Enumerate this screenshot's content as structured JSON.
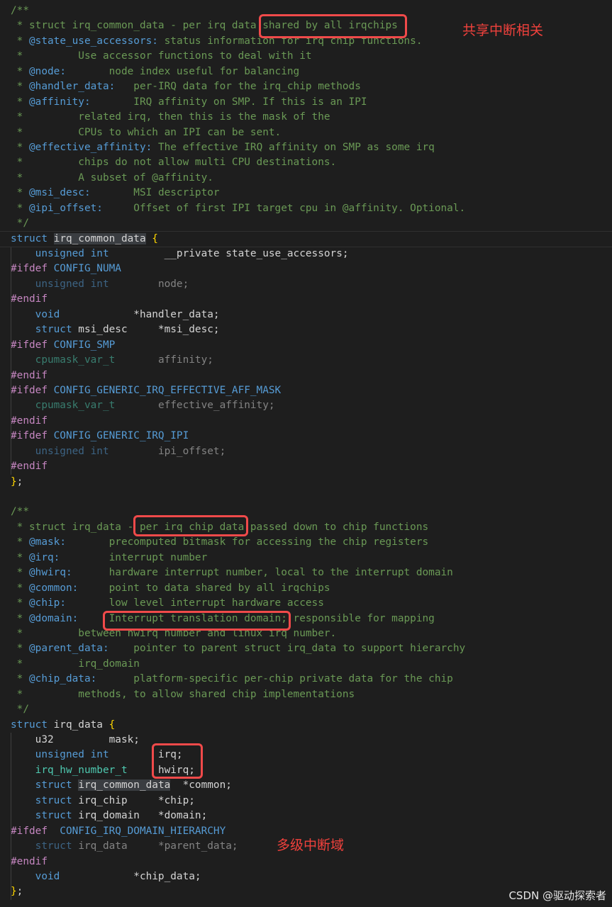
{
  "lines": [
    [
      {
        "t": "/**",
        "c": "c"
      }
    ],
    [
      {
        "t": " * struct irq_common_data - per irq data shared by all irqchips",
        "c": "c"
      }
    ],
    [
      {
        "t": " * ",
        "c": "c"
      },
      {
        "t": "@state_use_accessors:",
        "c": "ct"
      },
      {
        "t": " status information for irq chip functions.",
        "c": "c"
      }
    ],
    [
      {
        "t": " *         Use accessor functions to deal with it",
        "c": "c"
      }
    ],
    [
      {
        "t": " * ",
        "c": "c"
      },
      {
        "t": "@node:",
        "c": "ct"
      },
      {
        "t": "       node index useful for balancing",
        "c": "c"
      }
    ],
    [
      {
        "t": " * ",
        "c": "c"
      },
      {
        "t": "@handler_data:",
        "c": "ct"
      },
      {
        "t": "   per-IRQ data for the irq_chip methods",
        "c": "c"
      }
    ],
    [
      {
        "t": " * ",
        "c": "c"
      },
      {
        "t": "@affinity:",
        "c": "ct"
      },
      {
        "t": "       IRQ affinity on SMP. If this is an IPI",
        "c": "c"
      }
    ],
    [
      {
        "t": " *         related irq, then this is the mask of the",
        "c": "c"
      }
    ],
    [
      {
        "t": " *         CPUs to which an IPI can be sent.",
        "c": "c"
      }
    ],
    [
      {
        "t": " * ",
        "c": "c"
      },
      {
        "t": "@effective_affinity:",
        "c": "ct"
      },
      {
        "t": " The effective IRQ affinity on SMP as some irq",
        "c": "c"
      }
    ],
    [
      {
        "t": " *         chips do not allow multi CPU destinations.",
        "c": "c"
      }
    ],
    [
      {
        "t": " *         A subset of @affinity.",
        "c": "c"
      }
    ],
    [
      {
        "t": " * ",
        "c": "c"
      },
      {
        "t": "@msi_desc:",
        "c": "ct"
      },
      {
        "t": "       MSI descriptor",
        "c": "c"
      }
    ],
    [
      {
        "t": " * ",
        "c": "c"
      },
      {
        "t": "@ipi_offset:",
        "c": "ct"
      },
      {
        "t": "     Offset of first IPI target cpu in @affinity. Optional.",
        "c": "c"
      }
    ],
    [
      {
        "t": " */",
        "c": "c"
      }
    ],
    [
      {
        "t": "struct",
        "c": "k"
      },
      {
        "t": " ",
        "c": "x"
      },
      {
        "t": "irq_common_data",
        "c": "hl"
      },
      {
        "t": " ",
        "c": "x"
      },
      {
        "t": "{",
        "c": "b"
      }
    ],
    [
      {
        "t": "    ",
        "c": "x"
      },
      {
        "t": "unsigned int",
        "c": "k"
      },
      {
        "t": "         __private state_use_accessors;",
        "c": "f"
      }
    ],
    [
      {
        "t": "#ifdef",
        "c": "p"
      },
      {
        "t": " CONFIG_NUMA",
        "c": "m"
      }
    ],
    [
      {
        "t": "    unsigned int        ",
        "c": "k",
        "dim": true
      },
      {
        "t": "node;",
        "c": "f",
        "dim": true
      }
    ],
    [
      {
        "t": "#endif",
        "c": "p"
      }
    ],
    [
      {
        "t": "    ",
        "c": "x"
      },
      {
        "t": "void",
        "c": "k"
      },
      {
        "t": "            *handler_data;",
        "c": "f"
      }
    ],
    [
      {
        "t": "    ",
        "c": "x"
      },
      {
        "t": "struct",
        "c": "k"
      },
      {
        "t": " msi_desc     *msi_desc;",
        "c": "f"
      }
    ],
    [
      {
        "t": "#ifdef",
        "c": "p"
      },
      {
        "t": " CONFIG_SMP",
        "c": "m"
      }
    ],
    [
      {
        "t": "    cpumask_var_t       ",
        "c": "t",
        "dim": true
      },
      {
        "t": "affinity;",
        "c": "f",
        "dim": true
      }
    ],
    [
      {
        "t": "#endif",
        "c": "p"
      }
    ],
    [
      {
        "t": "#ifdef",
        "c": "p"
      },
      {
        "t": " CONFIG_GENERIC_IRQ_EFFECTIVE_AFF_MASK",
        "c": "m"
      }
    ],
    [
      {
        "t": "    cpumask_var_t       ",
        "c": "t",
        "dim": true
      },
      {
        "t": "effective_affinity;",
        "c": "f",
        "dim": true
      }
    ],
    [
      {
        "t": "#endif",
        "c": "p"
      }
    ],
    [
      {
        "t": "#ifdef",
        "c": "p"
      },
      {
        "t": " CONFIG_GENERIC_IRQ_IPI",
        "c": "m"
      }
    ],
    [
      {
        "t": "    unsigned int        ",
        "c": "k",
        "dim": true
      },
      {
        "t": "ipi_offset;",
        "c": "f",
        "dim": true
      }
    ],
    [
      {
        "t": "#endif",
        "c": "p"
      }
    ],
    [
      {
        "t": "}",
        "c": "b"
      },
      {
        "t": ";",
        "c": "x"
      }
    ],
    [],
    [
      {
        "t": "/**",
        "c": "c"
      }
    ],
    [
      {
        "t": " * struct irq_data - per irq chip data passed down to chip functions",
        "c": "c"
      }
    ],
    [
      {
        "t": " * ",
        "c": "c"
      },
      {
        "t": "@mask:",
        "c": "ct"
      },
      {
        "t": "       precomputed bitmask for accessing the chip registers",
        "c": "c"
      }
    ],
    [
      {
        "t": " * ",
        "c": "c"
      },
      {
        "t": "@irq:",
        "c": "ct"
      },
      {
        "t": "        interrupt number",
        "c": "c"
      }
    ],
    [
      {
        "t": " * ",
        "c": "c"
      },
      {
        "t": "@hwirq:",
        "c": "ct"
      },
      {
        "t": "      hardware interrupt number, local to the interrupt domain",
        "c": "c"
      }
    ],
    [
      {
        "t": " * ",
        "c": "c"
      },
      {
        "t": "@common:",
        "c": "ct"
      },
      {
        "t": "     point to data shared by all irqchips",
        "c": "c"
      }
    ],
    [
      {
        "t": " * ",
        "c": "c"
      },
      {
        "t": "@chip:",
        "c": "ct"
      },
      {
        "t": "       low level interrupt hardware access",
        "c": "c"
      }
    ],
    [
      {
        "t": " * ",
        "c": "c"
      },
      {
        "t": "@domain:",
        "c": "ct"
      },
      {
        "t": "     Interrupt translation domain; responsible for mapping",
        "c": "c"
      }
    ],
    [
      {
        "t": " *         between hwirq number and linux irq number.",
        "c": "c"
      }
    ],
    [
      {
        "t": " * ",
        "c": "c"
      },
      {
        "t": "@parent_data:",
        "c": "ct"
      },
      {
        "t": "    pointer to parent struct irq_data to support hierarchy",
        "c": "c"
      }
    ],
    [
      {
        "t": " *         irq_domain",
        "c": "c"
      }
    ],
    [
      {
        "t": " * ",
        "c": "c"
      },
      {
        "t": "@chip_data:",
        "c": "ct"
      },
      {
        "t": "      platform-specific per-chip private data for the chip",
        "c": "c"
      }
    ],
    [
      {
        "t": " *         methods, to allow shared chip implementations",
        "c": "c"
      }
    ],
    [
      {
        "t": " */",
        "c": "c"
      }
    ],
    [
      {
        "t": "struct",
        "c": "k"
      },
      {
        "t": " irq_data ",
        "c": "f"
      },
      {
        "t": "{",
        "c": "b"
      }
    ],
    [
      {
        "t": "    u32         mask;",
        "c": "f"
      }
    ],
    [
      {
        "t": "    ",
        "c": "x"
      },
      {
        "t": "unsigned int",
        "c": "k"
      },
      {
        "t": "        irq;",
        "c": "f"
      }
    ],
    [
      {
        "t": "    ",
        "c": "x"
      },
      {
        "t": "irq_hw_number_t",
        "c": "t"
      },
      {
        "t": "     hwirq;",
        "c": "f"
      }
    ],
    [
      {
        "t": "    ",
        "c": "x"
      },
      {
        "t": "struct",
        "c": "k"
      },
      {
        "t": " ",
        "c": "x"
      },
      {
        "t": "irq_common_data",
        "c": "hl"
      },
      {
        "t": "  *common;",
        "c": "f"
      }
    ],
    [
      {
        "t": "    ",
        "c": "x"
      },
      {
        "t": "struct",
        "c": "k"
      },
      {
        "t": " irq_chip     *chip;",
        "c": "f"
      }
    ],
    [
      {
        "t": "    ",
        "c": "x"
      },
      {
        "t": "struct",
        "c": "k"
      },
      {
        "t": " irq_domain   *domain;",
        "c": "f"
      }
    ],
    [
      {
        "t": "#ifdef",
        "c": "p"
      },
      {
        "t": "  CONFIG_IRQ_DOMAIN_HIERARCHY",
        "c": "m"
      }
    ],
    [
      {
        "t": "    struct ",
        "c": "k",
        "dim": true
      },
      {
        "t": "irq_data     *parent_data;",
        "c": "f",
        "dim": true
      }
    ],
    [
      {
        "t": "#endif",
        "c": "p"
      }
    ],
    [
      {
        "t": "    ",
        "c": "x"
      },
      {
        "t": "void",
        "c": "k"
      },
      {
        "t": "            *chip_data;",
        "c": "f"
      }
    ],
    [
      {
        "t": "}",
        "c": "b"
      },
      {
        "t": ";",
        "c": "x"
      }
    ]
  ],
  "annotations": {
    "note_shared": "共享中断相关",
    "note_hierarchy": "多级中断域"
  },
  "watermark": "CSDN @驱动探索者"
}
